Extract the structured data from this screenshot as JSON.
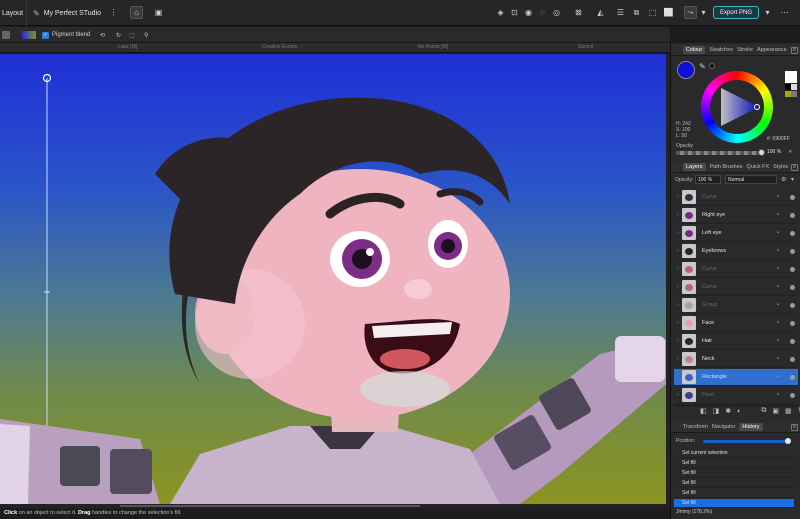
{
  "topbar": {
    "persona": "Layout",
    "document_title": "My Perfect STudio",
    "export_button": "Export PNG"
  },
  "context_bar": {
    "pigment_blend_label": "Pigment blend",
    "pigment_blend_checked": true
  },
  "rulers": {
    "labels": [
      "Lake [M]",
      "Creative Events",
      "No Points [M]",
      "Stencil"
    ]
  },
  "status": {
    "click": "Click",
    "click_text": "on an object to select it.",
    "drag": "Drag",
    "drag_text": "handles to change the selection's fill."
  },
  "colour_panel": {
    "tabs": [
      "Colour",
      "Swatches",
      "Stroke",
      "Appearance"
    ],
    "active_tab": "Colour",
    "h": "H: 242",
    "s": "S: 100",
    "l": "L: 50",
    "hex": "#: 0900FF",
    "opacity_label": "Opacity",
    "opacity_value": "100 %",
    "current_colour": "#0d10d8"
  },
  "layers_panel": {
    "tabs": [
      "Layers",
      "Path Brushes",
      "Quick FX",
      "Styles"
    ],
    "active_tab": "Layers",
    "opacity_label": "Opacity:",
    "opacity_value": "100 %",
    "blend_mode": "Normal",
    "layers": [
      {
        "name": "Curve",
        "dim": true,
        "selected": false
      },
      {
        "name": "Right eye",
        "dim": false,
        "selected": false
      },
      {
        "name": "Left eye",
        "dim": false,
        "selected": false
      },
      {
        "name": "Eyebrows",
        "dim": false,
        "selected": false
      },
      {
        "name": "Curve",
        "dim": true,
        "selected": false
      },
      {
        "name": "Curve",
        "dim": true,
        "selected": false
      },
      {
        "name": "Group",
        "dim": true,
        "selected": false
      },
      {
        "name": "Face",
        "dim": false,
        "selected": false
      },
      {
        "name": "Hair",
        "dim": false,
        "selected": false
      },
      {
        "name": "Neck",
        "dim": false,
        "selected": false
      },
      {
        "name": "Rectangle",
        "dim": false,
        "selected": true
      },
      {
        "name": "Pixel",
        "dim": true,
        "selected": false
      }
    ]
  },
  "history_panel": {
    "tabs": [
      "Transform",
      "Navigator",
      "History"
    ],
    "active_tab": "History",
    "position_label": "Position:",
    "position_fraction": 1.0,
    "items": [
      {
        "label": "Set current selection",
        "selected": false
      },
      {
        "label": "Set fill",
        "selected": false
      },
      {
        "label": "Set fill",
        "selected": false
      },
      {
        "label": "Set fill",
        "selected": false
      },
      {
        "label": "Set fill",
        "selected": false
      },
      {
        "label": "Set fill",
        "selected": true
      }
    ],
    "zoom_readout": "Jimmy (178.2%)"
  }
}
